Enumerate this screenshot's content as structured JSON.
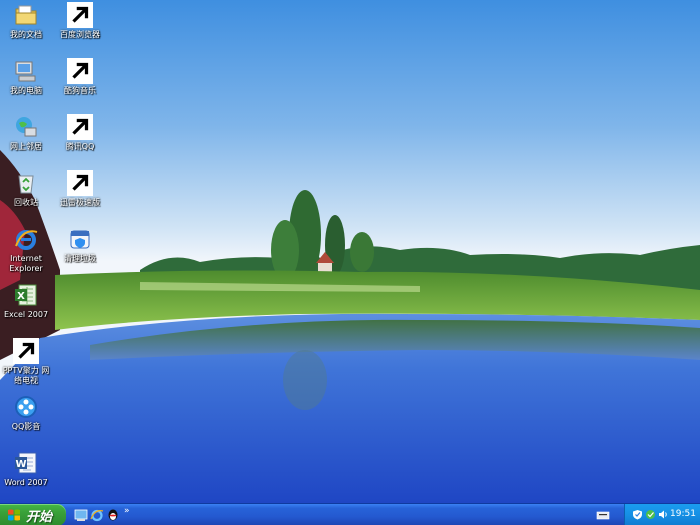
{
  "desktop": {
    "icons": [
      {
        "label": "我的文档"
      },
      {
        "label": "百度浏览器"
      },
      {
        "label": "我的电脑"
      },
      {
        "label": "酷狗音乐"
      },
      {
        "label": "网上邻居"
      },
      {
        "label": "腾讯QQ"
      },
      {
        "label": "回收站"
      },
      {
        "label": "迅雷极速版"
      },
      {
        "label": "Internet\nExplorer"
      },
      {
        "label": "清理垃圾"
      },
      {
        "label": "Excel 2007"
      },
      {
        "label": "PPTV聚力 网\n络电视"
      },
      {
        "label": "QQ影音"
      },
      {
        "label": "Word 2007"
      }
    ]
  },
  "taskbar": {
    "start_label": "开始",
    "quicklaunch_more": "»",
    "clock": "19:51"
  },
  "colors": {
    "taskbar_blue": "#2459d0",
    "start_green": "#3aa23a",
    "tray_blue": "#168fe4"
  }
}
